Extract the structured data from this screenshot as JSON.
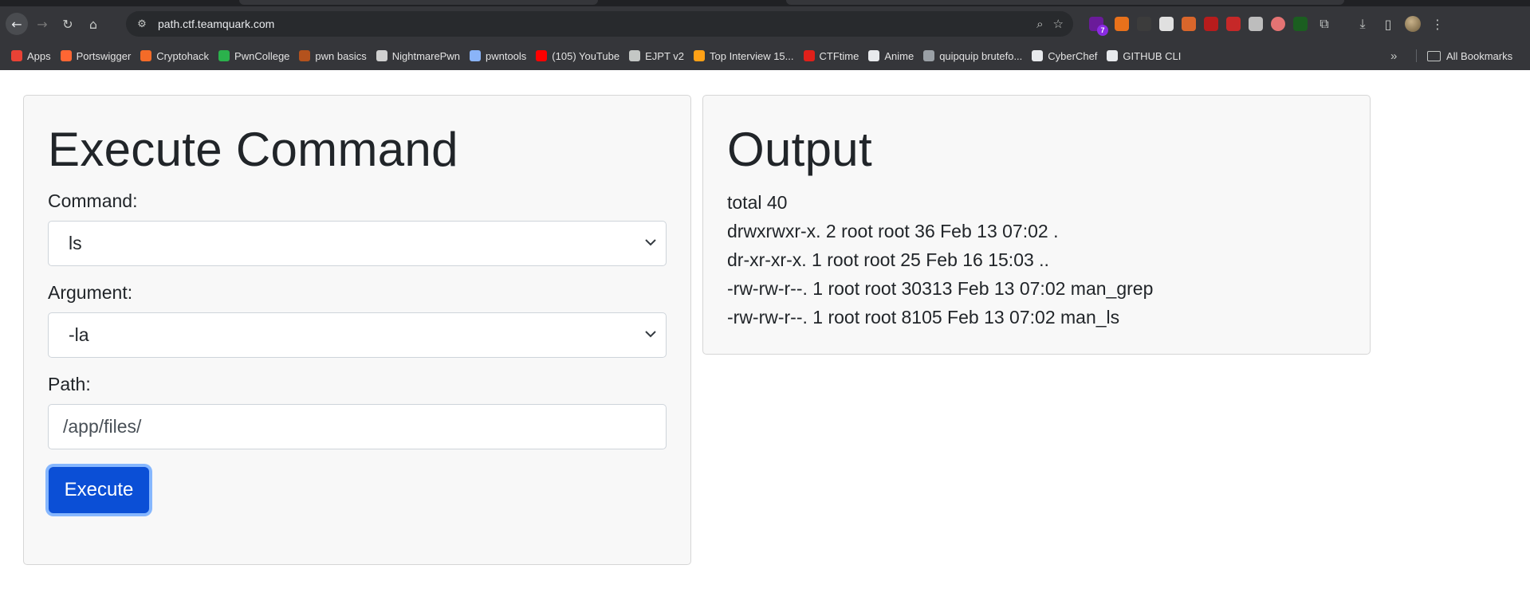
{
  "browser": {
    "url": "path.ctf.teamquark.com",
    "extension_badge": "7",
    "bookmarks": [
      {
        "label": "Apps",
        "color": "#e94235"
      },
      {
        "label": "Portswigger",
        "color": "#ff6633"
      },
      {
        "label": "Cryptohack",
        "color": "#f46b28"
      },
      {
        "label": "PwnCollege",
        "color": "#2bb24c"
      },
      {
        "label": "pwn basics",
        "color": "#b4521d"
      },
      {
        "label": "NightmarePwn",
        "color": "#d0d0d0"
      },
      {
        "label": "pwntools",
        "color": "#8ab4f8"
      },
      {
        "label": "(105) YouTube",
        "color": "#ff0000"
      },
      {
        "label": "EJPT v2",
        "color": "#c4c7c5"
      },
      {
        "label": "Top Interview 15...",
        "color": "#ffa116"
      },
      {
        "label": "CTFtime",
        "color": "#e0201a"
      },
      {
        "label": "Anime",
        "color": "#e8eaed"
      },
      {
        "label": "quipquip brutefo...",
        "color": "#9aa0a6"
      },
      {
        "label": "CyberChef",
        "color": "#e8eaed"
      },
      {
        "label": "GITHUB CLI",
        "color": "#e8eaed"
      }
    ],
    "all_bookmarks_label": "All Bookmarks"
  },
  "form": {
    "title": "Execute Command",
    "command_label": "Command:",
    "command_value": "ls",
    "argument_label": "Argument:",
    "argument_value": "-la",
    "path_label": "Path:",
    "path_value": "/app/files/",
    "execute_label": "Execute"
  },
  "output": {
    "title": "Output",
    "lines": [
      "total 40",
      "drwxrwxr-x. 2 root root 36 Feb 13 07:02 .",
      "dr-xr-xr-x. 1 root root 25 Feb 16 15:03 ..",
      "-rw-rw-r--. 1 root root 30313 Feb 13 07:02 man_grep",
      "-rw-rw-r--. 1 root root 8105 Feb 13 07:02 man_ls"
    ]
  }
}
